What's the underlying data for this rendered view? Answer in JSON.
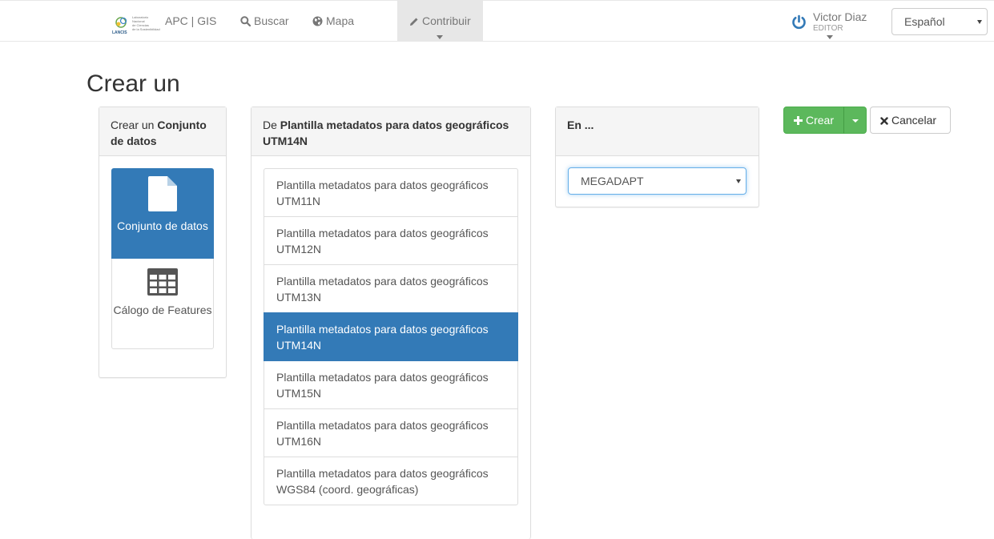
{
  "navbar": {
    "logo": {
      "brand": "LANCIS",
      "lines": [
        "Laboratorio",
        "Nacional",
        "de Ciencias",
        "de la Sostenibilidad"
      ]
    },
    "site_name": "APC | GIS",
    "search_label": "Buscar",
    "map_label": "Mapa",
    "contribute_label": "Contribuir",
    "user": {
      "name": "Victor Diaz",
      "role": "EDITOR"
    },
    "language": "Español"
  },
  "page": {
    "title": "Crear un"
  },
  "type_panel": {
    "heading_prefix": "Crear un",
    "heading_bold": "Conjunto de datos",
    "tiles": [
      {
        "label": "Conjunto de datos",
        "icon": "file-icon",
        "active": true
      },
      {
        "label": "Cálogo de Features",
        "icon": "table-icon",
        "active": false
      }
    ]
  },
  "template_panel": {
    "heading_prefix": "De",
    "heading_bold": "Plantilla metadatos para datos geográficos UTM14N",
    "items": [
      {
        "label": "Plantilla metadatos para datos geográficos UTM11N"
      },
      {
        "label": "Plantilla metadatos para datos geográficos UTM12N"
      },
      {
        "label": "Plantilla metadatos para datos geográficos UTM13N"
      },
      {
        "label": "Plantilla metadatos para datos geográficos UTM14N"
      },
      {
        "label": "Plantilla metadatos para datos geográficos UTM15N"
      },
      {
        "label": "Plantilla metadatos para datos geográficos UTM16N"
      },
      {
        "label": "Plantilla metadatos para datos geográficos WGS84 (coord. geográficas)"
      }
    ],
    "selected_index": 3
  },
  "group_panel": {
    "heading": "En ...",
    "selected_group": "MEGADAPT"
  },
  "actions": {
    "create_label": "Crear",
    "cancel_label": "Cancelar"
  },
  "colors": {
    "primary": "#337ab7",
    "success": "#5cb85c",
    "muted": "#777777"
  }
}
